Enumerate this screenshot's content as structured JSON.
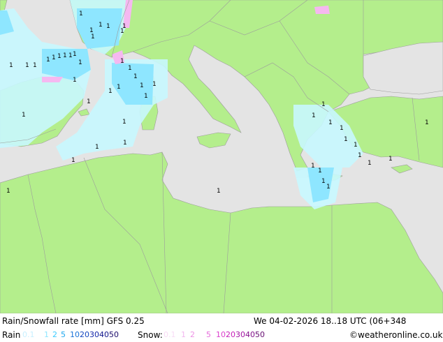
{
  "header": {
    "title": "Rain/Snowfall rate [mm] GFS 0.25",
    "datetime": "We 04-02-2026 18..18 UTC (06+348"
  },
  "legend": {
    "rain_label": "Rain",
    "rain_values": [
      "0.1",
      "1",
      "2",
      "5",
      "10",
      "20",
      "30",
      "40",
      "50"
    ],
    "rain_colors": [
      "#c8f0ff",
      "#8ee6ff",
      "#3ccbff",
      "#1ea8ee",
      "#1a73d9",
      "#1446c0",
      "#1225a8",
      "#0c118a",
      "#1a0a6a"
    ],
    "snow_label": "Snow:",
    "snow_values": [
      "0.1",
      "1",
      "2",
      "5",
      "10",
      "20",
      "30",
      "40",
      "50"
    ],
    "snow_colors": [
      "#f9dcf6",
      "#f3b8ef",
      "#ee92e6",
      "#e66bdb",
      "#dc3fce",
      "#c81fba",
      "#a313a3",
      "#84108c",
      "#650b70"
    ],
    "credit": "©weatheronline.co.uk"
  },
  "map": {
    "colors": {
      "sea": "#e4e4e4",
      "land": "#b4ee8c",
      "border": "#9c9c9c",
      "rain_light": "#c8f8ff",
      "rain": "#8ee6ff",
      "snow": "#f5b8f0",
      "marker": "#000000"
    },
    "marker_labels": [
      "1",
      "1",
      "1",
      "1",
      "1",
      "1",
      "1",
      "1",
      "1",
      "1",
      "1",
      "1",
      "1",
      "1",
      "1",
      "1",
      "1",
      "1",
      "1",
      "1",
      "1",
      "1",
      "1",
      "1",
      "1",
      "1",
      "1",
      "1",
      "1",
      "1",
      "1",
      "1",
      "1",
      "1",
      "1",
      "1",
      "1",
      "1",
      "1",
      "1",
      "1",
      "1",
      "1",
      "1",
      "1",
      "1",
      "1",
      "1"
    ]
  }
}
